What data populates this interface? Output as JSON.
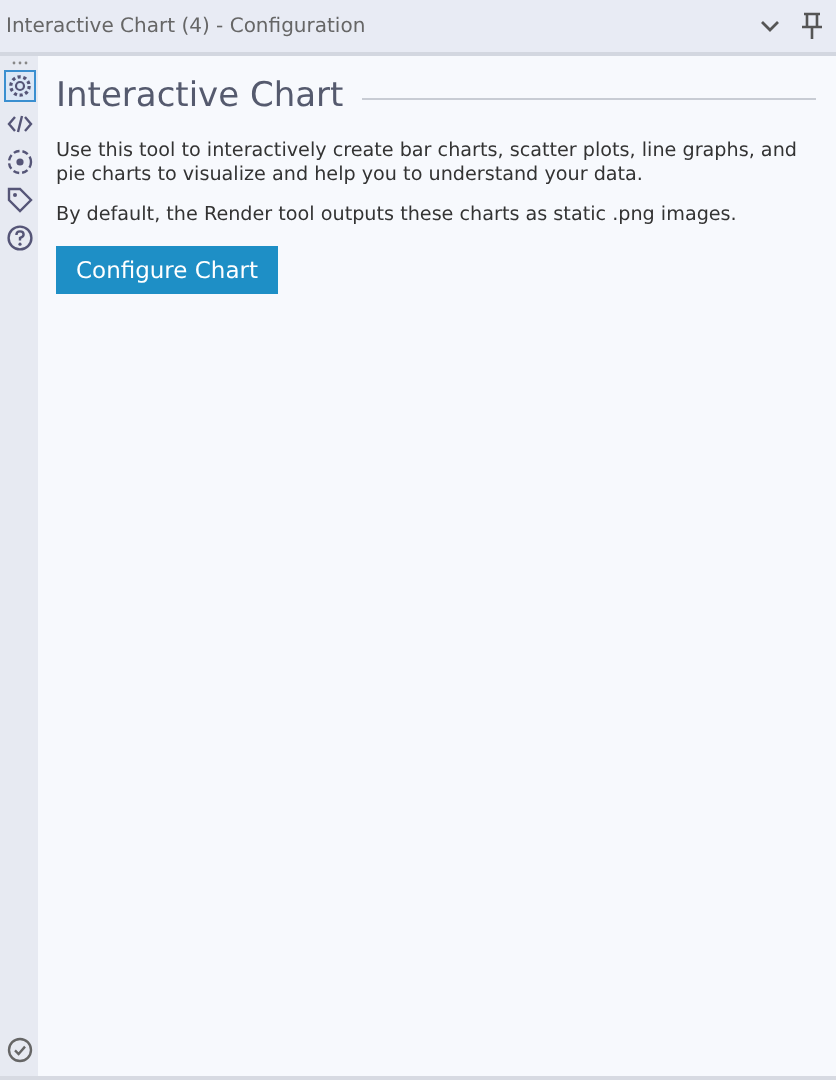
{
  "window": {
    "title": "Interactive Chart (4) - Configuration"
  },
  "sidebar": {
    "items": [
      {
        "kind": "gear",
        "selected": true
      },
      {
        "kind": "code",
        "selected": false
      },
      {
        "kind": "target",
        "selected": false
      },
      {
        "kind": "tag",
        "selected": false
      },
      {
        "kind": "help",
        "selected": false
      }
    ]
  },
  "heading": "Interactive Chart",
  "paragraphs": [
    "Use this tool to interactively create bar charts, scatter plots, line graphs, and pie charts to visualize and help you to understand your data.",
    "By default, the Render tool outputs these charts as static .png images."
  ],
  "button": "Configure Chart"
}
